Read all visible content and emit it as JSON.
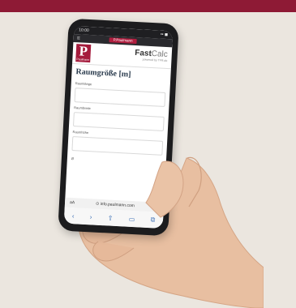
{
  "status": {
    "time": "10:00",
    "signal": "▪▪ ◼"
  },
  "browser": {
    "menu_icon": "hamburger-icon",
    "tab_label": "P.Paulmann"
  },
  "header": {
    "logo_letter": "P",
    "logo_text": "Paulmann",
    "app_name_1": "Fast",
    "app_name_2": "Calc",
    "powered": "powered by TFR.de"
  },
  "form": {
    "title": "Raumgröße [m]",
    "fields": [
      {
        "label": "Raumlänge"
      },
      {
        "label": "Raumbreite"
      },
      {
        "label": "Raumhöhe"
      }
    ],
    "extra_label": "Ø"
  },
  "urlbar": {
    "left": "aA",
    "url": "⊙ info.paulmann.com",
    "reload": "↻"
  },
  "nav": {
    "back": "‹",
    "forward": "›",
    "share": "⇧",
    "books": "▭",
    "tabs": "⧉"
  }
}
